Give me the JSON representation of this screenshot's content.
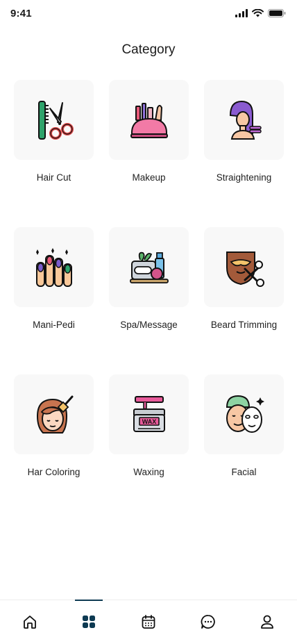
{
  "status_bar": {
    "time": "9:41"
  },
  "header": {
    "title": "Category"
  },
  "categories": [
    {
      "label": "Hair Cut",
      "icon": "comb-scissors-icon"
    },
    {
      "label": "Makeup",
      "icon": "makeup-kit-icon"
    },
    {
      "label": "Straightening",
      "icon": "hair-straightener-icon"
    },
    {
      "label": "Mani-Pedi",
      "icon": "manicure-nails-icon"
    },
    {
      "label": "Spa/Message",
      "icon": "spa-products-icon"
    },
    {
      "label": "Beard Trimming",
      "icon": "beard-scissors-icon"
    },
    {
      "label": "Har Coloring",
      "icon": "hair-coloring-icon"
    },
    {
      "label": "Waxing",
      "icon": "wax-jar-icon"
    },
    {
      "label": "Facial",
      "icon": "facial-mask-icon"
    }
  ],
  "bottom_nav": {
    "items": [
      {
        "name": "home",
        "icon": "home-icon",
        "active": false
      },
      {
        "name": "categories",
        "icon": "grid-icon",
        "active": true
      },
      {
        "name": "calendar",
        "icon": "calendar-icon",
        "active": false
      },
      {
        "name": "messages",
        "icon": "chat-icon",
        "active": false
      },
      {
        "name": "profile",
        "icon": "user-icon",
        "active": false
      }
    ],
    "active_color": "#0d3a52"
  }
}
